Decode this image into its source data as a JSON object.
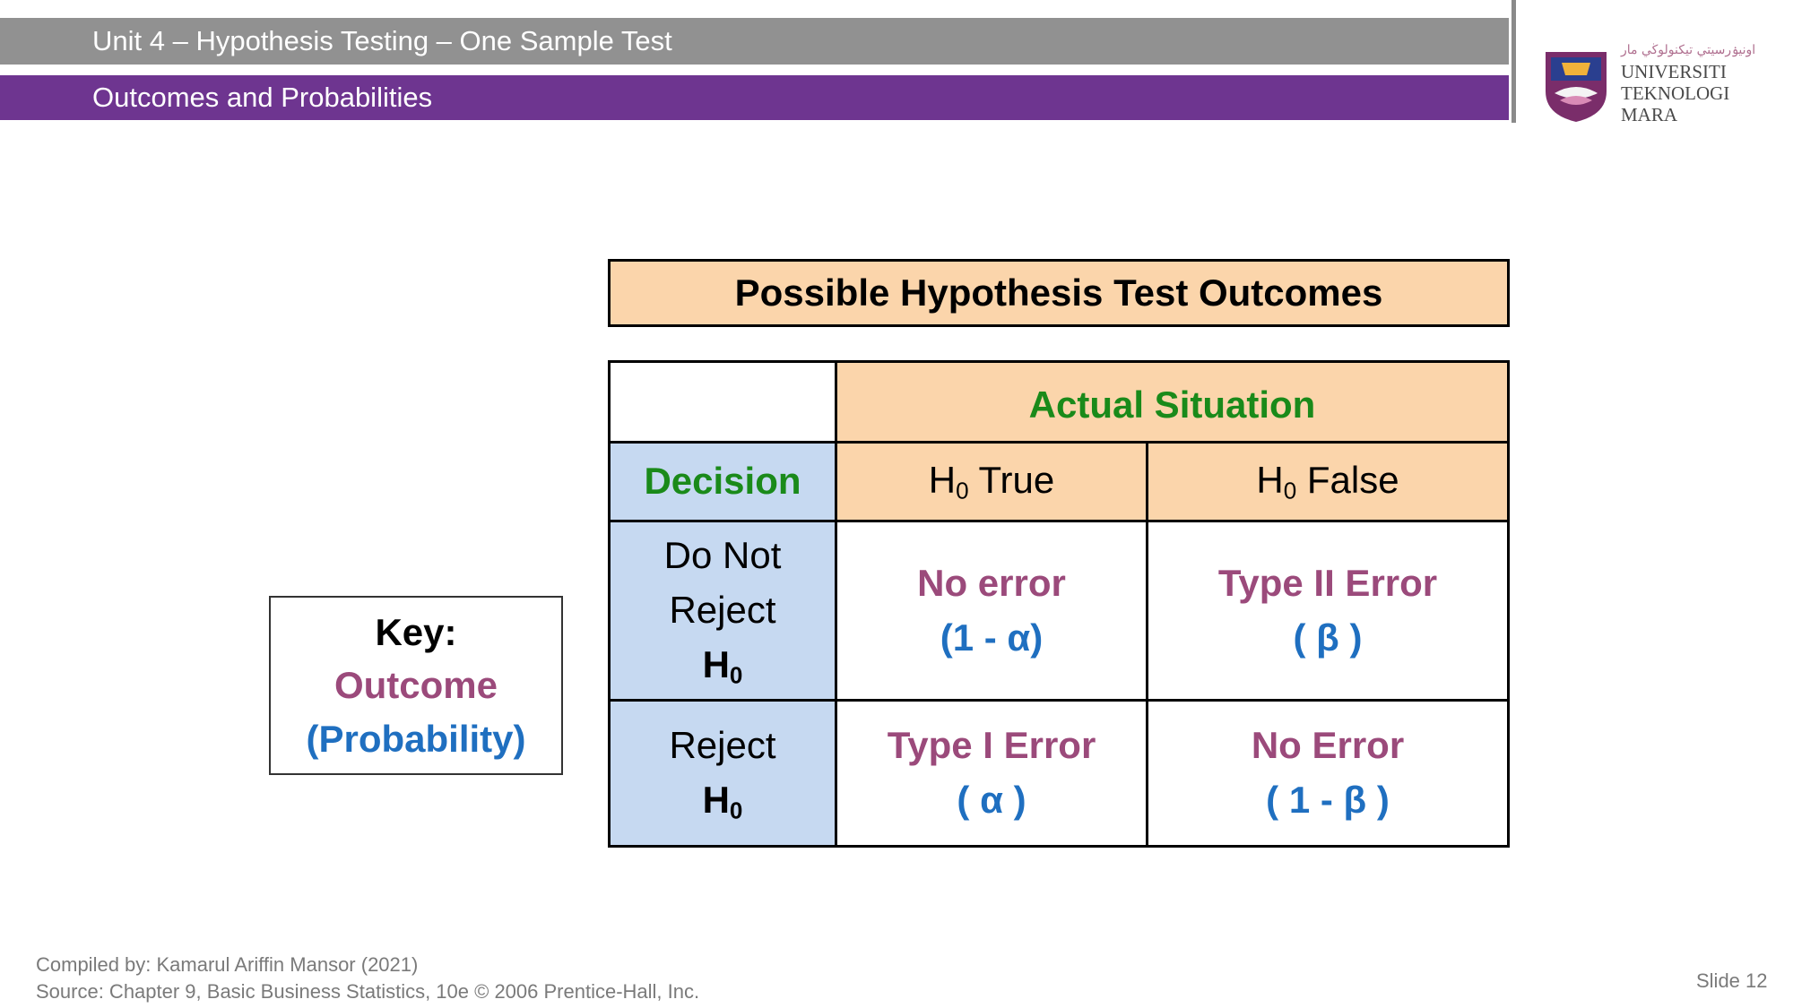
{
  "header": {
    "unit_title": "Unit 4 – Hypothesis Testing – One Sample Test",
    "section_title": "Outcomes and Probabilities",
    "logo": {
      "icon": "uitm-crest-logo",
      "jawi_text": "اونيۏرسيتي تيكنولوڬي مار",
      "line1": "UNIVERSITI",
      "line2": "TEKNOLOGI",
      "line3": "MARA"
    }
  },
  "table": {
    "title": "Possible Hypothesis Test Outcomes",
    "actual_situation": "Actual Situation",
    "decision": "Decision",
    "col1": {
      "h": "H",
      "sub": "0",
      "rest": " True"
    },
    "col2": {
      "h": "H",
      "sub": "0",
      "rest": " False"
    },
    "row1": {
      "line1": "Do Not",
      "line2": "Reject",
      "h": "H",
      "sub": "0"
    },
    "row2": {
      "line1": "Reject",
      "h": "H",
      "sub": "0"
    },
    "cells": {
      "r1c1": {
        "outcome": "No error",
        "prob": "(1 - α)"
      },
      "r1c2": {
        "outcome": "Type II Error",
        "prob": "( β )"
      },
      "r2c1": {
        "outcome": "Type I Error",
        "prob": "( α )"
      },
      "r2c2": {
        "outcome": "No Error",
        "prob": "( 1 - β )"
      }
    }
  },
  "key": {
    "title": "Key:",
    "outcome": "Outcome",
    "probability": "(Probability)"
  },
  "footer": {
    "compiled_by": "Compiled by: Kamarul Ariffin Mansor (2021)",
    "source": "Source: Chapter 9, Basic Business Statistics, 10e © 2006 Prentice-Hall, Inc.",
    "slide_number": "Slide 12"
  },
  "colors": {
    "header_grey": "#919191",
    "header_purple": "#6e3590",
    "peach": "#fbd5ab",
    "decision_blue": "#c6d9f1",
    "green_text": "#1a8a1a",
    "outcome_text": "#9b4a7b",
    "probability_text": "#1f6fc0"
  }
}
